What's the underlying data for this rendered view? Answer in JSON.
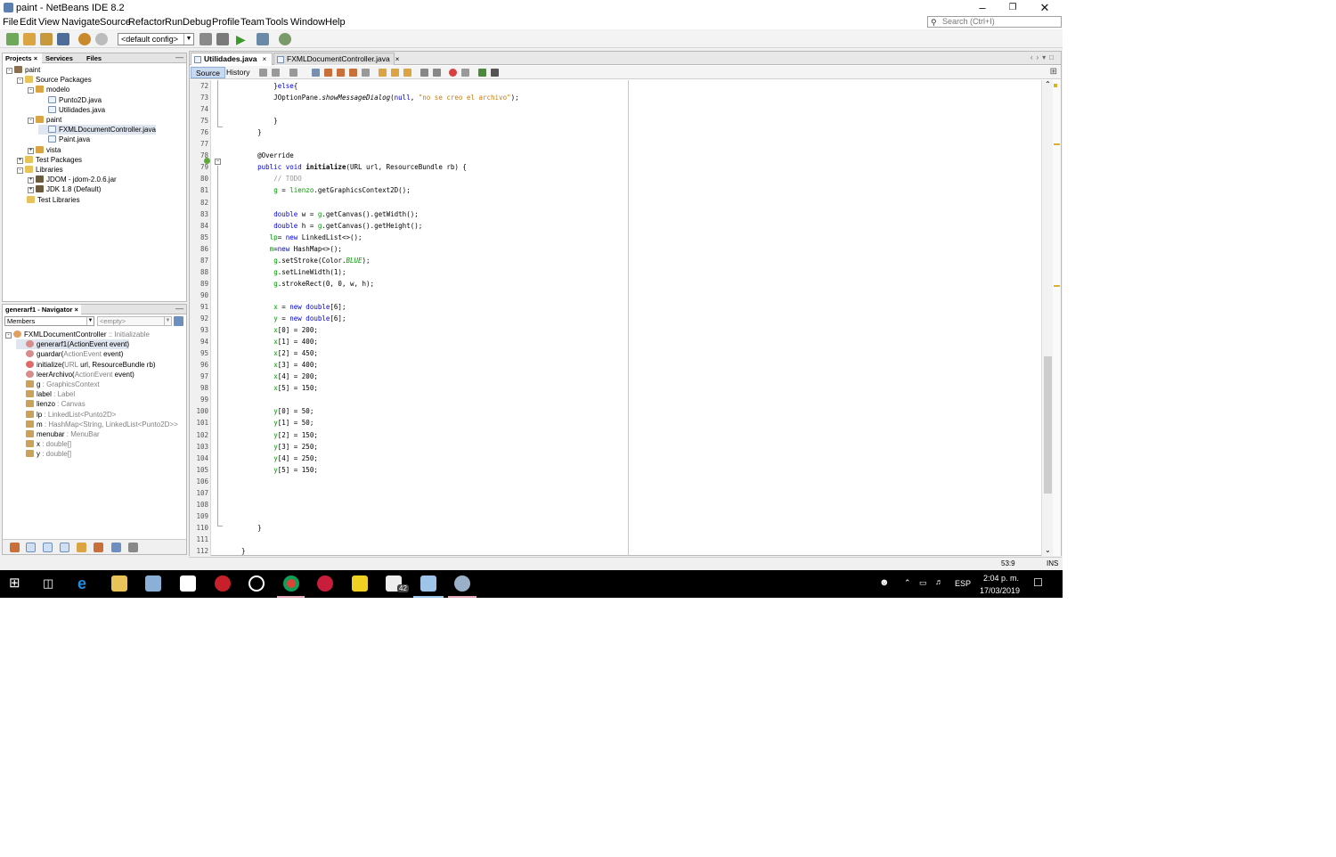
{
  "window": {
    "title": "paint - NetBeans IDE 8.2"
  },
  "menu": [
    "File",
    "Edit",
    "View",
    "Navigate",
    "Source",
    "Refactor",
    "Run",
    "Debug",
    "Profile",
    "Team",
    "Tools",
    "Window",
    "Help"
  ],
  "search": {
    "placeholder": "Search (Ctrl+I)"
  },
  "toolbar": {
    "config": "<default config>"
  },
  "projects_pane": {
    "tabs": [
      "Projects",
      "Services",
      "Files"
    ],
    "tree": [
      {
        "label": "paint",
        "indent": 0,
        "icon": "proj",
        "exp": "-"
      },
      {
        "label": "Source Packages",
        "indent": 1,
        "icon": "folder",
        "exp": "-"
      },
      {
        "label": "modelo",
        "indent": 2,
        "icon": "pkg",
        "exp": "-"
      },
      {
        "label": "Punto2D.java",
        "indent": 3,
        "icon": "java"
      },
      {
        "label": "Utilidades.java",
        "indent": 3,
        "icon": "java"
      },
      {
        "label": "paint",
        "indent": 2,
        "icon": "pkg",
        "exp": "-"
      },
      {
        "label": "FXMLDocumentController.java",
        "indent": 3,
        "icon": "java",
        "selected": true
      },
      {
        "label": "Paint.java",
        "indent": 3,
        "icon": "java"
      },
      {
        "label": "vista",
        "indent": 2,
        "icon": "pkg",
        "exp": "+"
      },
      {
        "label": "Test Packages",
        "indent": 1,
        "icon": "folder",
        "exp": "+"
      },
      {
        "label": "Libraries",
        "indent": 1,
        "icon": "folder",
        "exp": "-"
      },
      {
        "label": "JDOM - jdom-2.0.6.jar",
        "indent": 2,
        "icon": "jar",
        "exp": "+"
      },
      {
        "label": "JDK 1.8 (Default)",
        "indent": 2,
        "icon": "jar",
        "exp": "+"
      },
      {
        "label": "Test Libraries",
        "indent": 1,
        "icon": "folder"
      }
    ]
  },
  "navigator": {
    "tab": "generarf1 - Navigator",
    "members_label": "Members",
    "filter_placeholder": "<empty>",
    "items": [
      {
        "name": "FXMLDocumentController",
        "type": " :: Initializable",
        "indent": 0,
        "icon": "cls",
        "exp": "-"
      },
      {
        "name": "generarf1(ActionEvent event)",
        "type": "",
        "indent": 1,
        "icon": "meth",
        "selected": true
      },
      {
        "name": "guardar(",
        "type": "ActionEvent",
        "suffix": " event)",
        "indent": 1,
        "icon": "meth"
      },
      {
        "name": "initialize(",
        "type": "URL",
        "suffix": " url, ResourceBundle rb)",
        "indent": 1,
        "icon": "ctor"
      },
      {
        "name": "leerArchivo(",
        "type": "ActionEvent",
        "suffix": " event)",
        "indent": 1,
        "icon": "meth"
      },
      {
        "name": "g",
        "type": " : GraphicsContext",
        "indent": 1,
        "icon": "fld"
      },
      {
        "name": "label",
        "type": " : Label",
        "indent": 1,
        "icon": "fld"
      },
      {
        "name": "lienzo",
        "type": " : Canvas",
        "indent": 1,
        "icon": "fld"
      },
      {
        "name": "lp",
        "type": " : LinkedList<Punto2D>",
        "indent": 1,
        "icon": "fld"
      },
      {
        "name": "m",
        "type": " : HashMap<String, LinkedList<Punto2D>>",
        "indent": 1,
        "icon": "fld"
      },
      {
        "name": "menubar",
        "type": " : MenuBar",
        "indent": 1,
        "icon": "fld"
      },
      {
        "name": "x",
        "type": " : double[]",
        "indent": 1,
        "icon": "fld"
      },
      {
        "name": "y",
        "type": " : double[]",
        "indent": 1,
        "icon": "fld"
      }
    ]
  },
  "editor": {
    "tabs": [
      {
        "label": "Utilidades.java",
        "active": true
      },
      {
        "label": "FXMLDocumentController.java",
        "active": false
      }
    ],
    "modes": [
      "Source",
      "History"
    ],
    "lines": [
      {
        "n": "72",
        "html": "            }<span class=\"kw\">else</span>{"
      },
      {
        "n": "73",
        "html": "            JOptionPane.<span class=\"it\">showMessageDialog</span>(<span class=\"kw\">null</span>, <span class=\"str\">\"no se creo el archivo\"</span>);"
      },
      {
        "n": "74",
        "html": ""
      },
      {
        "n": "75",
        "html": "            }"
      },
      {
        "n": "76",
        "html": "        }"
      },
      {
        "n": "77",
        "html": ""
      },
      {
        "n": "78",
        "html": "        @Override"
      },
      {
        "n": "79",
        "html": "        <span class=\"kw\">public void</span> <span class=\"bold\">initialize</span>(URL url, ResourceBundle rb) {"
      },
      {
        "n": "80",
        "html": "            <span class=\"cmt\">// TODO</span>"
      },
      {
        "n": "81",
        "html": "            <span class=\"fld2\">g</span> = <span class=\"fld2\">lienzo</span>.getGraphicsContext2D();"
      },
      {
        "n": "82",
        "html": ""
      },
      {
        "n": "83",
        "html": "            <span class=\"kw\">double</span> w = <span class=\"fld2\">g</span>.getCanvas().getWidth();"
      },
      {
        "n": "84",
        "html": "            <span class=\"kw\">double</span> h = <span class=\"fld2\">g</span>.getCanvas().getHeight();"
      },
      {
        "n": "85",
        "html": "           <span class=\"fld2\">lp</span>= <span class=\"kw\">new</span> LinkedList&lt;&gt;();"
      },
      {
        "n": "86",
        "html": "           <span class=\"fld2\">m</span>=<span class=\"kw\">new</span> HashMap&lt;&gt;();"
      },
      {
        "n": "87",
        "html": "            <span class=\"fld2\">g</span>.setStroke(Color.<span class=\"it fld2\">BLUE</span>);"
      },
      {
        "n": "88",
        "html": "            <span class=\"fld2\">g</span>.setLineWidth(1);"
      },
      {
        "n": "89",
        "html": "            <span class=\"fld2\">g</span>.strokeRect(0, 0, w, h);"
      },
      {
        "n": "90",
        "html": ""
      },
      {
        "n": "91",
        "html": "            <span class=\"fld2\">x</span> = <span class=\"kw\">new double</span>[6];"
      },
      {
        "n": "92",
        "html": "            <span class=\"fld2\">y</span> = <span class=\"kw\">new double</span>[6];"
      },
      {
        "n": "93",
        "html": "            <span class=\"fld2\">x</span>[0] = 200;"
      },
      {
        "n": "94",
        "html": "            <span class=\"fld2\">x</span>[1] = 400;"
      },
      {
        "n": "95",
        "html": "            <span class=\"fld2\">x</span>[2] = 450;"
      },
      {
        "n": "96",
        "html": "            <span class=\"fld2\">x</span>[3] = 400;"
      },
      {
        "n": "97",
        "html": "            <span class=\"fld2\">x</span>[4] = 200;"
      },
      {
        "n": "98",
        "html": "            <span class=\"fld2\">x</span>[5] = 150;"
      },
      {
        "n": "99",
        "html": ""
      },
      {
        "n": "100",
        "html": "            <span class=\"fld2\">y</span>[0] = 50;"
      },
      {
        "n": "101",
        "html": "            <span class=\"fld2\">y</span>[1] = 50;"
      },
      {
        "n": "102",
        "html": "            <span class=\"fld2\">y</span>[2] = 150;"
      },
      {
        "n": "103",
        "html": "            <span class=\"fld2\">y</span>[3] = 250;"
      },
      {
        "n": "104",
        "html": "            <span class=\"fld2\">y</span>[4] = 250;"
      },
      {
        "n": "105",
        "html": "            <span class=\"fld2\">y</span>[5] = 150;"
      },
      {
        "n": "106",
        "html": ""
      },
      {
        "n": "107",
        "html": ""
      },
      {
        "n": "108",
        "html": ""
      },
      {
        "n": "109",
        "html": ""
      },
      {
        "n": "110",
        "html": "        }"
      },
      {
        "n": "111",
        "html": ""
      },
      {
        "n": "112",
        "html": "    }"
      }
    ]
  },
  "status": {
    "position": "53:9",
    "mode": "INS"
  },
  "taskbar": {
    "mail_badge": "42",
    "language": "ESP",
    "time": "2:04 p. m.",
    "date": "17/03/2019"
  }
}
